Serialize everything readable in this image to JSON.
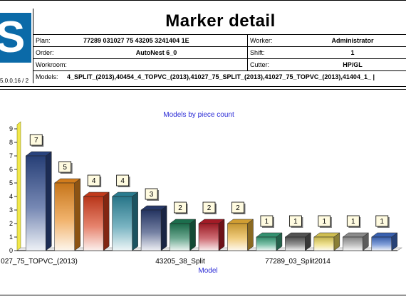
{
  "header": {
    "logo_text": "S",
    "version": "5.0.0.16 / 2",
    "title": "Marker detail",
    "plan_label": "Plan:",
    "plan_value": "77289 031027 75 43205 3241404 1E",
    "worker_label": "Worker:",
    "worker_value": "Administrator",
    "order_label": "Order:",
    "order_value": "AutoNest 6_0",
    "shift_label": "Shift:",
    "shift_value": "1",
    "workroom_label": "Workroom:",
    "workroom_value": "",
    "cutter_label": "Cutter:",
    "cutter_value": "HP/GL",
    "models_label": "Models:",
    "models_value": "4_SPLIT_(2013),40454_4_TOPVC_(2013),41027_75_SPLIT_(2013),41027_75_TOPVC_(2013),41404_1_   |"
  },
  "chart_data": {
    "type": "bar",
    "title": "Models by piece count",
    "xlabel": "Model",
    "ylabel": "",
    "ylim": [
      0,
      9
    ],
    "yticks": [
      0,
      1,
      2,
      3,
      4,
      5,
      6,
      7,
      8,
      9
    ],
    "grid": false,
    "legend": "none",
    "x_tick_labels": [
      "027_75_TOPVC_(2013)",
      "43205_38_Split",
      "77289_03_Split2014"
    ],
    "values": [
      7,
      5,
      4,
      4,
      3,
      2,
      2,
      2,
      1,
      1,
      1,
      1,
      1
    ],
    "colors": [
      "#2e4a8c",
      "#e98a1f",
      "#d8401e",
      "#2f8aa0",
      "#2a3d72",
      "#1f7a55",
      "#b51e2a",
      "#e8b038",
      "#3aa17c",
      "#5c5c5c",
      "#e6d35a",
      "#9a9a9a",
      "#3f6cc4"
    ]
  }
}
